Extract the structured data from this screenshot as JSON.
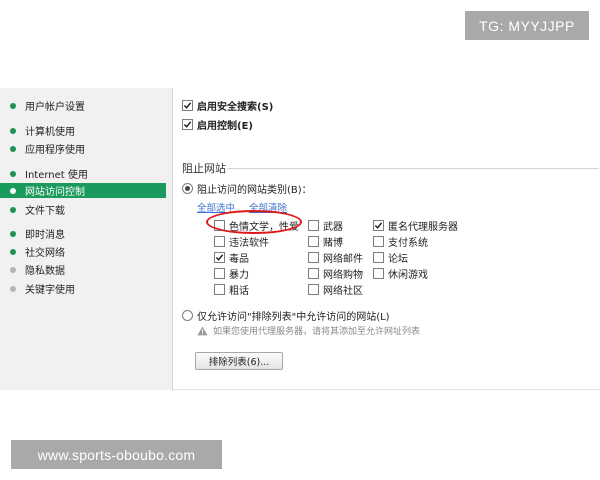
{
  "watermarks": {
    "top": "TG: MYYJJPP",
    "bottom": "www.sports-oboubo.com"
  },
  "sidebar": {
    "items": [
      {
        "label": "用户帐户设置"
      },
      {
        "label": "计算机使用"
      },
      {
        "label": "应用程序使用"
      },
      {
        "label": "Internet 使用"
      },
      {
        "label": "网站访问控制",
        "active": true
      },
      {
        "label": "文件下载"
      },
      {
        "label": "即时消息"
      },
      {
        "label": "社交网络"
      },
      {
        "label": "隐私数据"
      },
      {
        "label": "关键字使用"
      }
    ]
  },
  "options": {
    "safe_search": {
      "label": "启用安全搜索(S)",
      "checked": true
    },
    "enable_control": {
      "label": "启用控制(E)",
      "checked": true
    }
  },
  "block_sites": {
    "title": "阻止网站",
    "block_categories_label": "阻止访问的网站类别(B)：",
    "select_all": "全部选中",
    "clear_all": "全部清除",
    "categories": [
      {
        "label": "色情文学，性爱",
        "checked": false
      },
      {
        "label": "违法软件",
        "checked": false
      },
      {
        "label": "毒品",
        "checked": true
      },
      {
        "label": "暴力",
        "checked": false
      },
      {
        "label": "粗话",
        "checked": false
      },
      {
        "label": "武器",
        "checked": false
      },
      {
        "label": "赌博",
        "checked": false
      },
      {
        "label": "网络邮件",
        "checked": false
      },
      {
        "label": "网络购物",
        "checked": false
      },
      {
        "label": "网络社区",
        "checked": false
      },
      {
        "label": "匿名代理服务器",
        "checked": true
      },
      {
        "label": "支付系统",
        "checked": false
      },
      {
        "label": "论坛",
        "checked": false
      },
      {
        "label": "休闲游戏",
        "checked": false
      }
    ],
    "allow_only_label": "仅允许访问\"排除列表\"中允许访问的网站(L)",
    "proxy_note": "如果您使用代理服务器，请将其添加至允许网址列表",
    "exclusion_button": "排除列表(6)..."
  },
  "colors": {
    "accent": "#1a9a5c",
    "link": "#3d6fd1",
    "annotation": "#e01818"
  }
}
